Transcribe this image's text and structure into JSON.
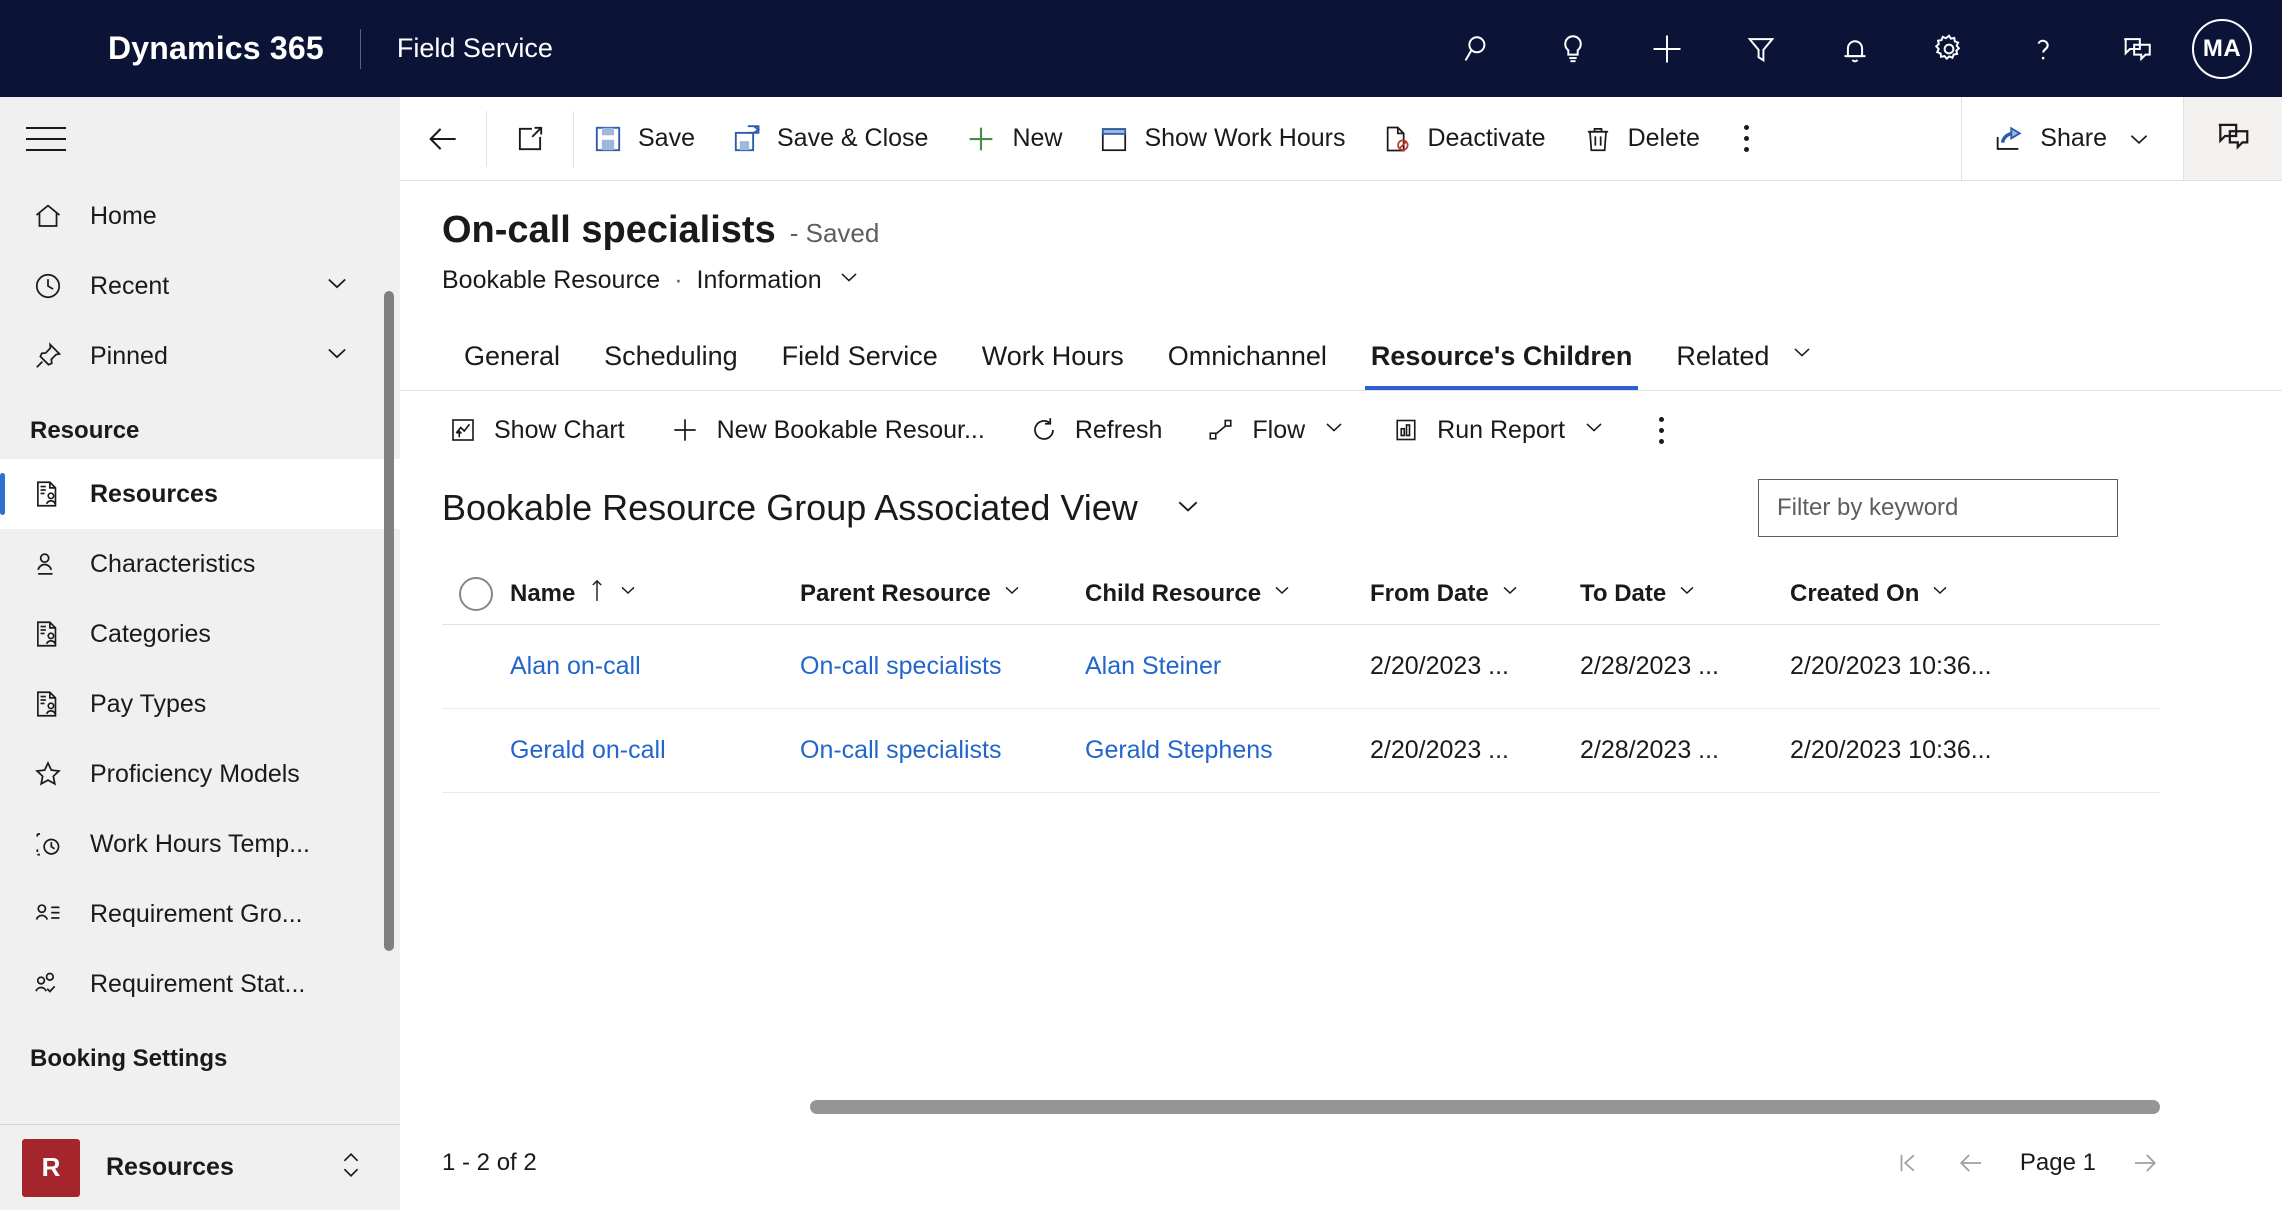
{
  "topbar": {
    "brand": "Dynamics 365",
    "app_name": "Field Service",
    "background": "#0b1437",
    "icons": [
      {
        "name": "search-icon",
        "label": "Search"
      },
      {
        "name": "lightbulb-icon",
        "label": "Assistant"
      },
      {
        "name": "plus-icon",
        "label": "Quick create"
      },
      {
        "name": "filter-icon",
        "label": "Filter"
      },
      {
        "name": "bell-icon",
        "label": "Notifications"
      },
      {
        "name": "gear-icon",
        "label": "Settings"
      },
      {
        "name": "help-icon",
        "label": "Help"
      },
      {
        "name": "chat-icon",
        "label": "Chat"
      }
    ],
    "avatar_initials": "MA"
  },
  "sidebar": {
    "items": [
      {
        "label": "Home",
        "icon": "home-icon",
        "chevron": false,
        "active": false
      },
      {
        "label": "Recent",
        "icon": "clock-icon",
        "chevron": true,
        "active": false
      },
      {
        "label": "Pinned",
        "icon": "pin-icon",
        "chevron": true,
        "active": false
      }
    ],
    "group_resource": "Resource",
    "resource_items": [
      {
        "label": "Resources",
        "icon": "resource-icon",
        "active": true
      },
      {
        "label": "Characteristics",
        "icon": "characteristics-icon",
        "active": false
      },
      {
        "label": "Categories",
        "icon": "resource-icon",
        "active": false
      },
      {
        "label": "Pay Types",
        "icon": "resource-icon",
        "active": false
      },
      {
        "label": "Proficiency Models",
        "icon": "star-icon",
        "active": false
      },
      {
        "label": "Work Hours Temp...",
        "icon": "work-hours-template-icon",
        "active": false
      },
      {
        "label": "Requirement Gro...",
        "icon": "requirement-group-icon",
        "active": false
      },
      {
        "label": "Requirement Stat...",
        "icon": "requirement-status-icon",
        "active": false
      }
    ],
    "group_booking": "Booking Settings",
    "area_switcher": {
      "badge": "R",
      "label": "Resources",
      "badge_color": "#a4262c"
    }
  },
  "commandbar": {
    "back": "back-arrow",
    "popout": "pop-out-icon",
    "buttons": [
      {
        "label": "Save",
        "icon": "save-icon"
      },
      {
        "label": "Save & Close",
        "icon": "save-close-icon"
      },
      {
        "label": "New",
        "icon": "plus-icon"
      },
      {
        "label": "Show Work Hours",
        "icon": "calendar-icon"
      },
      {
        "label": "Deactivate",
        "icon": "deactivate-icon"
      },
      {
        "label": "Delete",
        "icon": "trash-icon"
      }
    ],
    "overflow": "more-commands",
    "share_label": "Share",
    "chat_panel": "chat-panel-icon"
  },
  "record": {
    "title": "On-call specialists",
    "saved_status": "- Saved",
    "entity": "Bookable Resource",
    "separator": "·",
    "form_name": "Information"
  },
  "tabs": [
    {
      "label": "General",
      "active": false
    },
    {
      "label": "Scheduling",
      "active": false
    },
    {
      "label": "Field Service",
      "active": false
    },
    {
      "label": "Work Hours",
      "active": false
    },
    {
      "label": "Omnichannel",
      "active": false
    },
    {
      "label": "Resource's Children",
      "active": true
    },
    {
      "label": "Related",
      "active": false,
      "chevron": true
    }
  ],
  "subgrid": {
    "toolbar": [
      {
        "label": "Show Chart",
        "icon": "show-chart-icon",
        "chevron": false
      },
      {
        "label": "New Bookable Resour...",
        "icon": "plus-icon",
        "chevron": false
      },
      {
        "label": "Refresh",
        "icon": "refresh-icon",
        "chevron": false
      },
      {
        "label": "Flow",
        "icon": "flow-icon",
        "chevron": true
      },
      {
        "label": "Run Report",
        "icon": "run-report-icon",
        "chevron": true
      }
    ],
    "overflow": "more-commands",
    "view_name": "Bookable Resource Group Associated View",
    "search_placeholder": "Filter by keyword",
    "search_value": "",
    "columns": [
      {
        "label": "Name",
        "sorted": true,
        "sort_dir": "asc"
      },
      {
        "label": "Parent Resource",
        "sorted": false
      },
      {
        "label": "Child Resource",
        "sorted": false
      },
      {
        "label": "From Date",
        "sorted": false
      },
      {
        "label": "To Date",
        "sorted": false
      },
      {
        "label": "Created On",
        "sorted": false
      }
    ],
    "rows": [
      {
        "name": "Alan on-call",
        "parent_resource": "On-call specialists",
        "child_resource": "Alan Steiner",
        "from_date": "2/20/2023 ...",
        "to_date": "2/28/2023 ...",
        "created_on": "2/20/2023 10:36..."
      },
      {
        "name": "Gerald on-call",
        "parent_resource": "On-call specialists",
        "child_resource": "Gerald Stephens",
        "from_date": "2/20/2023 ...",
        "to_date": "2/28/2023 ...",
        "created_on": "2/20/2023 10:36..."
      }
    ],
    "record_count": "1 - 2 of 2",
    "page_label": "Page 1"
  },
  "colors": {
    "accent": "#2f5fd0",
    "link": "#2266cc",
    "header_bg": "#0b1437",
    "sidebar_bg": "#f0f0f0"
  }
}
